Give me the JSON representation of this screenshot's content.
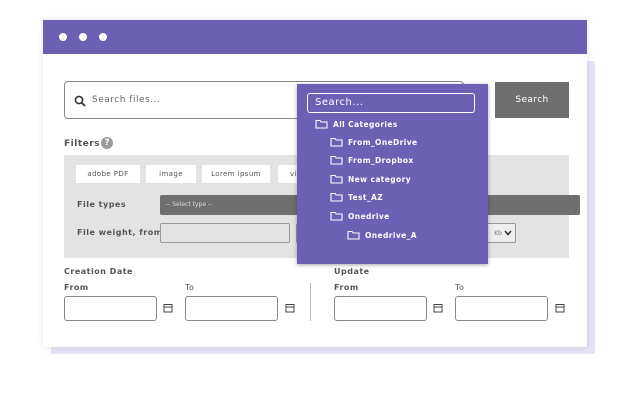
{
  "search": {
    "placeholder": "Search files...",
    "button_label": "Search"
  },
  "filters": {
    "label": "Filters",
    "info_glyph": "?",
    "chips": [
      "adobe PDF",
      "image",
      "Lorem ipsum",
      "vi"
    ],
    "file_types_label": "File types",
    "file_types_value": "-- Select type --",
    "file_weight_label": "File weight, from",
    "unit_value": "Kb"
  },
  "dates": {
    "creation_label": "Creation Date",
    "creation_from": "From",
    "creation_to": "To",
    "update_label": "Update",
    "update_from": "From",
    "update_to": "To"
  },
  "dropdown": {
    "search_placeholder": "Search...",
    "items": [
      {
        "label": "All Categories",
        "depth": 0
      },
      {
        "label": "From_OneDrive",
        "depth": 1
      },
      {
        "label": "From_Dropbox",
        "depth": 1
      },
      {
        "label": "New category",
        "depth": 1
      },
      {
        "label": "Test_AZ",
        "depth": 1
      },
      {
        "label": "Onedrive",
        "depth": 1
      },
      {
        "label": "Onedrive_A",
        "depth": 2
      }
    ]
  },
  "colors": {
    "accent": "#6b60b3",
    "button_grey": "#6f6f6f",
    "panel_grey": "#e3e3e3"
  }
}
